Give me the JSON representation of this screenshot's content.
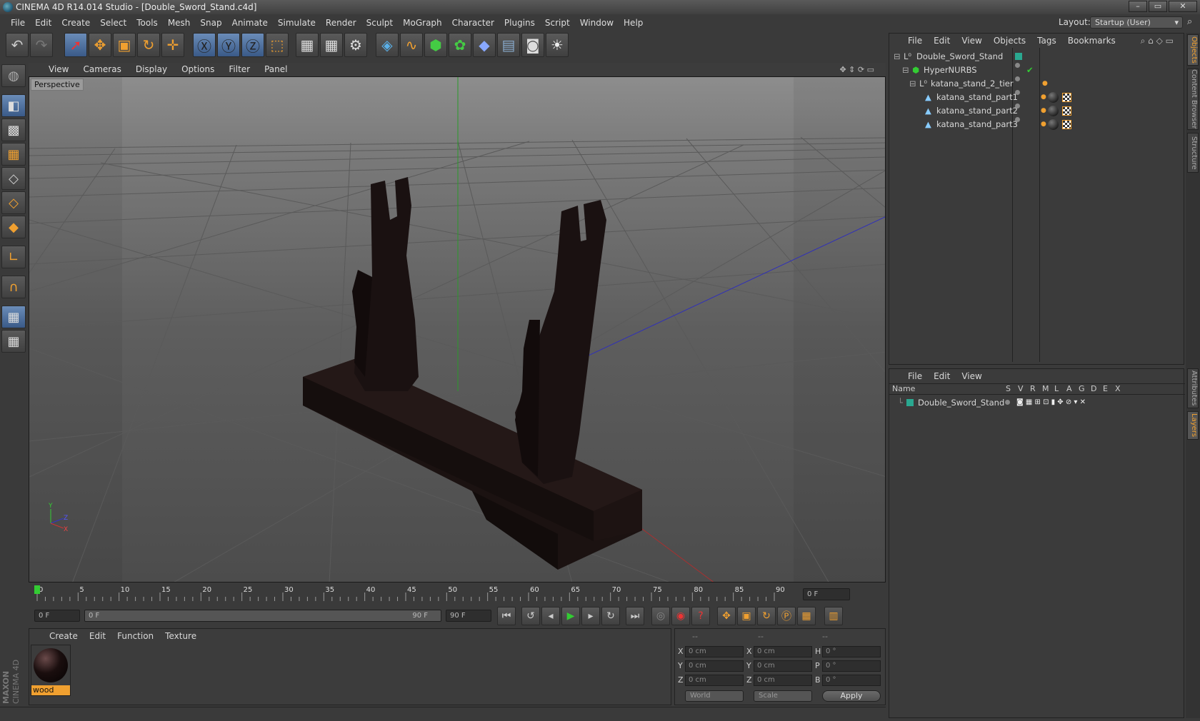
{
  "window": {
    "title": "CINEMA 4D R14.014 Studio - [Double_Sword_Stand.c4d]",
    "buttons": [
      "–",
      "▭",
      "✕"
    ]
  },
  "menubar": [
    "File",
    "Edit",
    "Create",
    "Select",
    "Tools",
    "Mesh",
    "Snap",
    "Animate",
    "Simulate",
    "Render",
    "Sculpt",
    "MoGraph",
    "Character",
    "Plugins",
    "Script",
    "Window",
    "Help"
  ],
  "layout": {
    "label": "Layout:",
    "value": "Startup (User)"
  },
  "viewport": {
    "menu": [
      "View",
      "Cameras",
      "Display",
      "Options",
      "Filter",
      "Panel"
    ],
    "label": "Perspective",
    "axes": {
      "y": "Y",
      "z": "Z",
      "x": "X"
    }
  },
  "timeline": {
    "ticks": [
      "0",
      "5",
      "10",
      "15",
      "20",
      "25",
      "30",
      "35",
      "40",
      "45",
      "50",
      "55",
      "60",
      "65",
      "70",
      "75",
      "80",
      "85",
      "90"
    ],
    "current_frame": "0 F",
    "start": "0 F",
    "range_start": "0 F",
    "range_end": "90 F",
    "end": "90 F"
  },
  "material_panel": {
    "menu": [
      "Create",
      "Edit",
      "Function",
      "Texture"
    ],
    "materials": [
      {
        "name": "wood"
      }
    ]
  },
  "coords": {
    "headers": [
      "--",
      "--",
      "--"
    ],
    "rows": [
      {
        "a": "X",
        "av": "0 cm",
        "b": "X",
        "bv": "0 cm",
        "c": "H",
        "cv": "0 °"
      },
      {
        "a": "Y",
        "av": "0 cm",
        "b": "Y",
        "bv": "0 cm",
        "c": "P",
        "cv": "0 °"
      },
      {
        "a": "Z",
        "av": "0 cm",
        "b": "Z",
        "bv": "0 cm",
        "c": "B",
        "cv": "0 °"
      }
    ],
    "mode": "World",
    "type": "Scale",
    "apply": "Apply"
  },
  "objects_panel": {
    "menu": [
      "File",
      "Edit",
      "View",
      "Objects",
      "Tags",
      "Bookmarks"
    ],
    "items": [
      {
        "name": "Double_Sword_Stand"
      },
      {
        "name": "HyperNURBS"
      },
      {
        "name": "katana_stand_2_tier"
      },
      {
        "name": "katana_stand_part1"
      },
      {
        "name": "katana_stand_part2"
      },
      {
        "name": "katana_stand_part3"
      }
    ]
  },
  "layers_panel": {
    "menu": [
      "File",
      "Edit",
      "View"
    ],
    "name_header": "Name",
    "columns": [
      "S",
      "V",
      "R",
      "M",
      "L",
      "A",
      "G",
      "D",
      "E",
      "X"
    ],
    "items": [
      {
        "name": "Double_Sword_Stand"
      }
    ]
  },
  "side_tabs": [
    "Objects",
    "Content Browser",
    "Structure",
    "Attributes",
    "Layers"
  ],
  "brand": {
    "maxon": "MAXON",
    "product": "CINEMA 4D"
  },
  "colors": {
    "accent": "#f0a030",
    "layer": "#2aa890",
    "select": "#5a7fb0"
  }
}
